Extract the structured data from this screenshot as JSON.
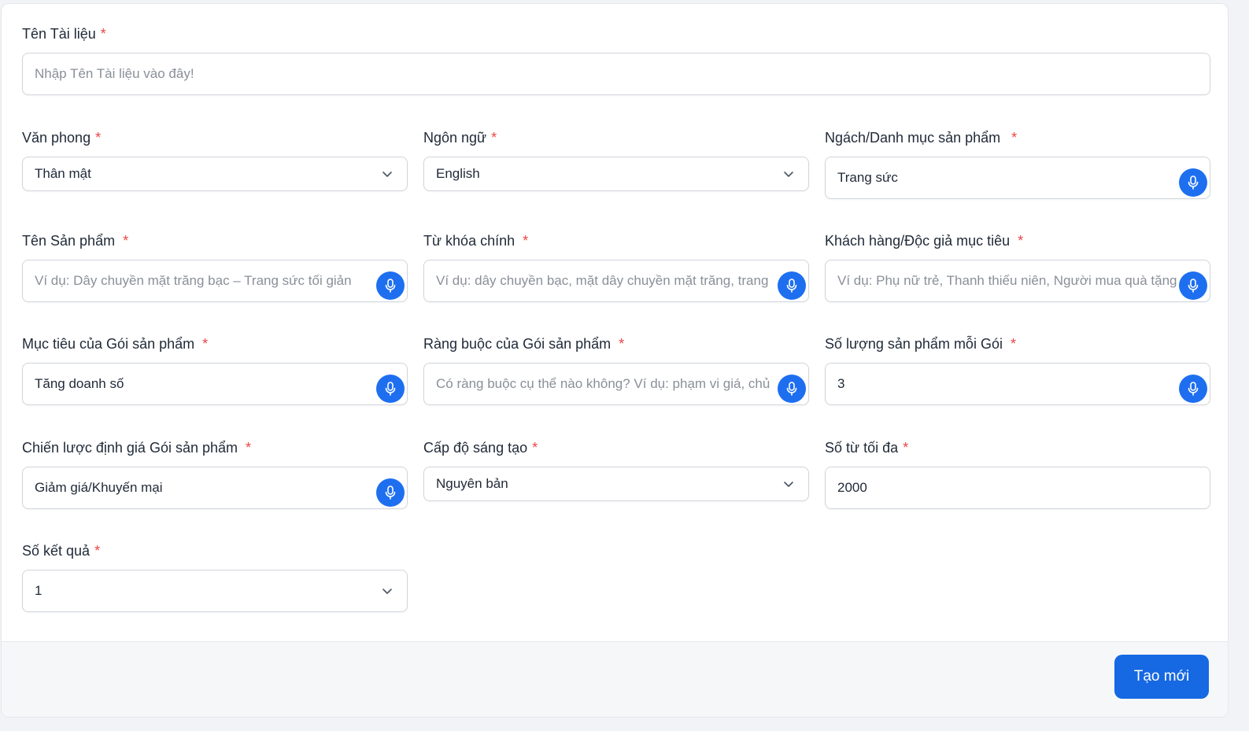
{
  "colors": {
    "accent": "#1e6ff0",
    "required": "#ef4444",
    "button": "#1668e3"
  },
  "required_mark": "*",
  "fields": {
    "doc_name": {
      "label": "Tên Tài liệu",
      "placeholder": "Nhập Tên Tài liệu vào đây!"
    },
    "tone": {
      "label": "Văn phong",
      "value": "Thân mật"
    },
    "language": {
      "label": "Ngôn ngữ",
      "value": "English"
    },
    "category": {
      "label": "Ngách/Danh mục sản phẩm",
      "value": "Trang sức",
      "icon": "microphone-icon"
    },
    "product_name": {
      "label": "Tên Sản phẩm",
      "placeholder": "Ví dụ: Dây chuyền mặt trăng bạc – Trang sức tối giản",
      "icon": "microphone-icon"
    },
    "keywords": {
      "label": "Từ khóa chính",
      "placeholder": "Ví dụ: dây chuyền bạc, mặt dây chuyền mặt trăng, trang",
      "icon": "microphone-icon"
    },
    "audience": {
      "label": "Khách hàng/Độc giả mục tiêu",
      "placeholder": "Ví dụ: Phụ nữ trẻ, Thanh thiếu niên, Người mua quà tặng",
      "icon": "microphone-icon"
    },
    "bundle_goal": {
      "label": "Mục tiêu của Gói sản phẩm",
      "value": "Tăng doanh số",
      "icon": "microphone-icon"
    },
    "bundle_constraints": {
      "label": "Ràng buộc của Gói sản phẩm",
      "placeholder": "Có ràng buộc cụ thể nào không? Ví dụ: phạm vi giá, chủ",
      "icon": "microphone-icon"
    },
    "products_per_bundle": {
      "label": "Số lượng sản phẩm mỗi Gói",
      "value": "3",
      "icon": "microphone-icon"
    },
    "pricing_strategy": {
      "label": "Chiến lược định giá Gói sản phẩm",
      "value": "Giảm giá/Khuyến mại",
      "icon": "microphone-icon"
    },
    "creativity": {
      "label": "Cấp độ sáng tạo",
      "value": "Nguyên bản"
    },
    "max_words": {
      "label": "Số từ tối đa",
      "value": "2000"
    },
    "result_count": {
      "label": "Số kết quả",
      "value": "1"
    }
  },
  "footer": {
    "submit_label": "Tạo mới"
  }
}
